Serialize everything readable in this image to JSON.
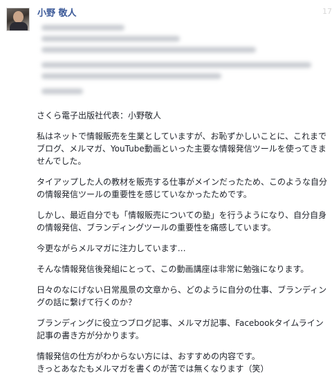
{
  "post": {
    "author": "小野 敬人",
    "timestamp": "17",
    "lines": [
      "さくら電子出版社代表：小野敬人",
      "私はネットで情報販売を生業としていますが、お恥ずかしいことに、これまでブログ、メルマガ、YouTube動画といった主要な情報発信ツールを使ってきませんでした。",
      "タイアップした人の教材を販売する仕事がメインだったため、このような自分の情報発信ツールの重要性を感じていなかったためです。",
      "しかし、最近自分でも「情報販売についての塾」を行うようになり、自分自身の情報発信、ブランディングツールの重要性を痛感しています。",
      "今更ながらメルマガに注力しています…",
      "そんな情報発信後発組にとって、この動画講座は非常に勉強になります。",
      "日々のなにげない日常風景の文章から、どのように自分の仕事、ブランディングの話に繋げて行くのか？",
      "ブランディングに役立つブログ記事、メルマガ記事、Facebookタイムライン記事の書き方が分かります。",
      "情報発信の仕方がわからない方には、おすすめの内容です。\nきっとあなたもメルマガを書くのが苦では無くなります（笑）"
    ]
  },
  "colors": {
    "author_link": "#3b5998",
    "text": "#1d2129"
  }
}
